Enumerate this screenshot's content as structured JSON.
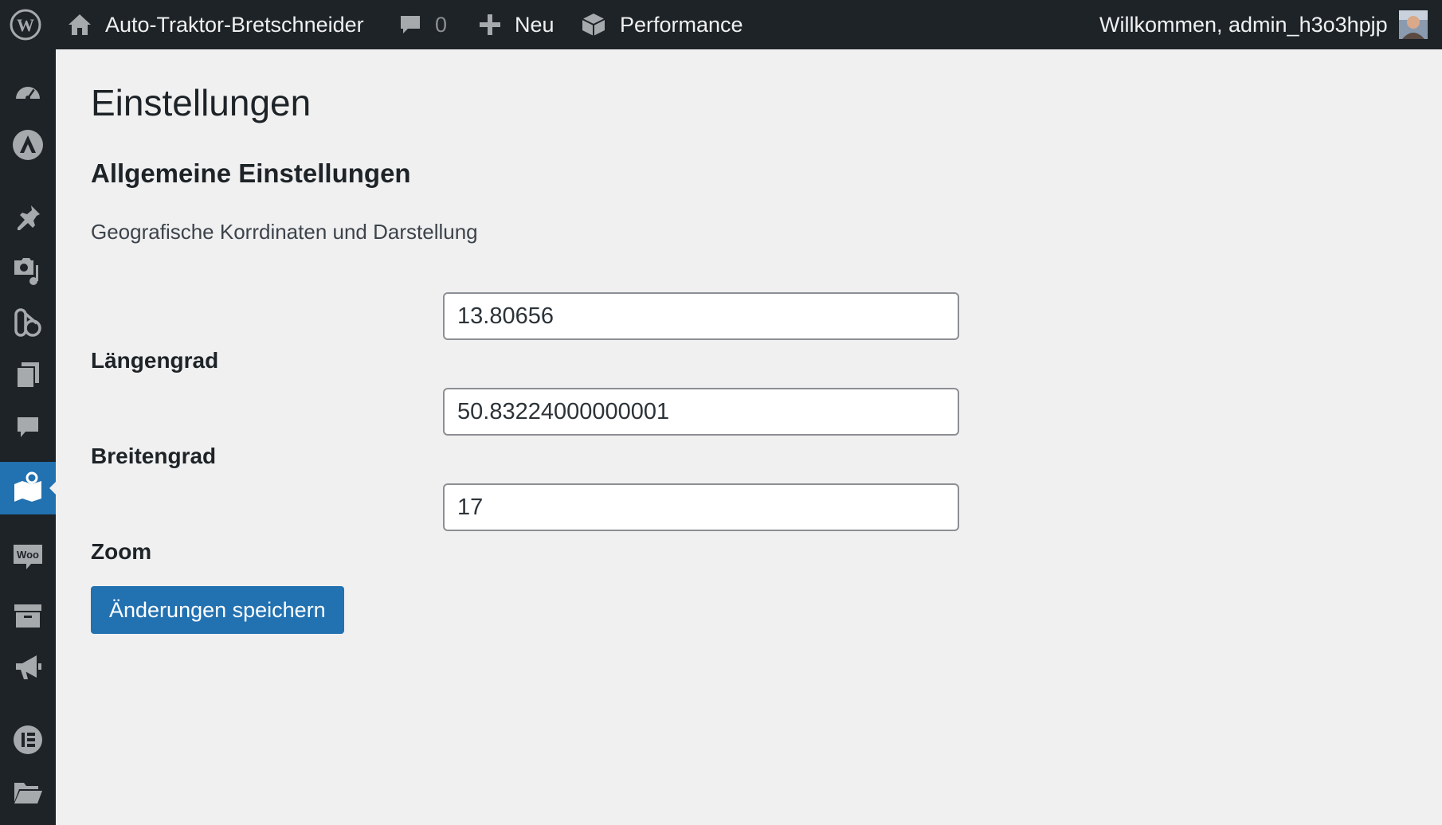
{
  "adminbar": {
    "site_name": "Auto-Traktor-Bretschneider",
    "comments_count": "0",
    "new_label": "Neu",
    "performance_label": "Performance",
    "greeting": "Willkommen, admin_h3o3hpjp"
  },
  "sidebar": {
    "items": [
      {
        "icon": "dashboard-icon"
      },
      {
        "icon": "astra-icon"
      },
      {
        "icon": "posts-pin-icon"
      },
      {
        "icon": "media-icon"
      },
      {
        "icon": "block-editor-icon"
      },
      {
        "icon": "pages-icon"
      },
      {
        "icon": "comments-icon"
      },
      {
        "icon": "map-icon",
        "current": true
      },
      {
        "icon": "woo-icon"
      },
      {
        "icon": "archive-icon"
      },
      {
        "icon": "marketing-megaphone-icon"
      },
      {
        "icon": "elementor-icon"
      },
      {
        "icon": "folder-icon"
      }
    ]
  },
  "page": {
    "title": "Einstellungen",
    "section_title": "Allgemeine Einstellungen",
    "section_description": "Geografische Korrdinaten und Darstellung",
    "fields": [
      {
        "label": "Längengrad",
        "value": "13.80656"
      },
      {
        "label": "Breitengrad",
        "value": "50.83224000000001"
      },
      {
        "label": "Zoom",
        "value": "17"
      }
    ],
    "save_label": "Änderungen speichern"
  },
  "colors": {
    "adminbar_bg": "#1d2327",
    "accent": "#2271b1",
    "page_bg": "#f0f0f1"
  }
}
